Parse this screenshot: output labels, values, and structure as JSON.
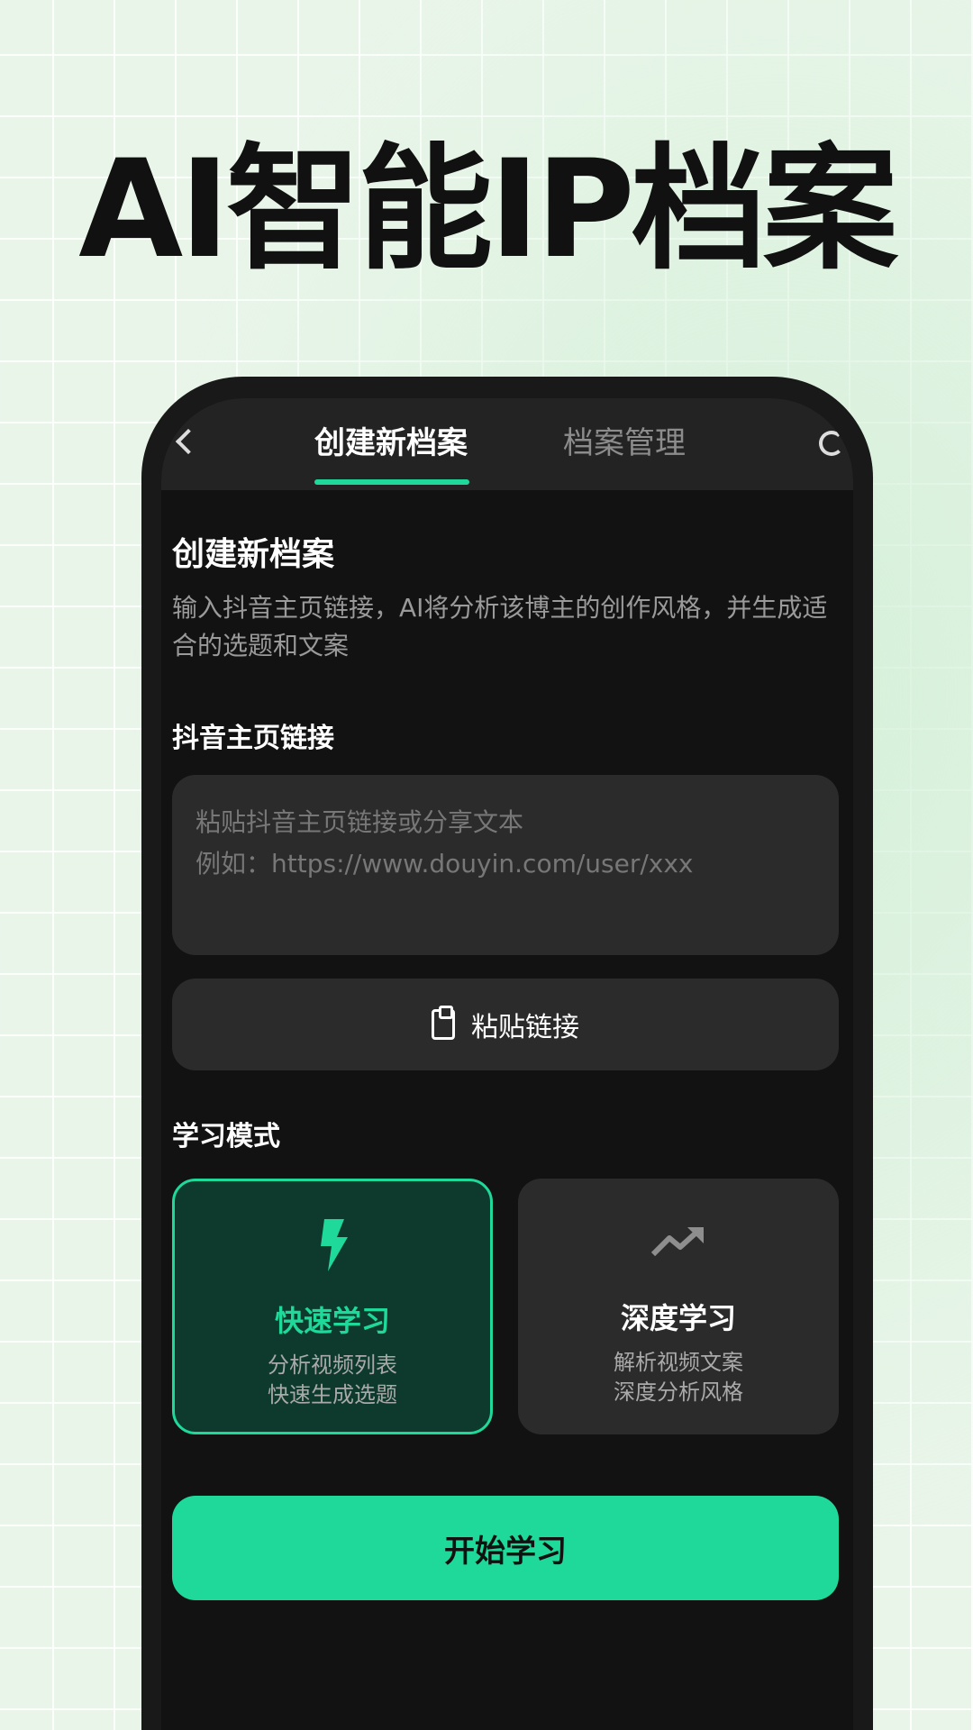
{
  "hero": {
    "title": "AI智能IP档案"
  },
  "header": {
    "tabs": [
      {
        "label": "创建新档案",
        "active": true
      },
      {
        "label": "档案管理",
        "active": false
      }
    ],
    "back_icon": "back-arrow-icon",
    "right_icon": "refresh-icon"
  },
  "main": {
    "title": "创建新档案",
    "description": "输入抖音主页链接，AI将分析该博主的创作风格，并生成适合的选题和文案",
    "link_field": {
      "label": "抖音主页链接",
      "value": "",
      "placeholder": "粘贴抖音主页链接或分享文本\n例如：https://www.douyin.com/user/xxx"
    },
    "paste_button": {
      "icon": "clipboard-icon",
      "label": "粘贴链接"
    },
    "mode_section": {
      "label": "学习模式",
      "modes": [
        {
          "icon": "lightning-bolt-icon",
          "title": "快速学习",
          "desc_line1": "分析视频列表",
          "desc_line2": "快速生成选题",
          "selected": true
        },
        {
          "icon": "trending-up-icon",
          "title": "深度学习",
          "desc_line1": "解析视频文案",
          "desc_line2": "深度分析风格",
          "selected": false
        }
      ]
    },
    "start_button": {
      "label": "开始学习"
    }
  },
  "colors": {
    "accent": "#1ed99a",
    "card": "#2b2b2b",
    "selected_card": "#0d3a2c",
    "screen_bg": "#121212"
  }
}
